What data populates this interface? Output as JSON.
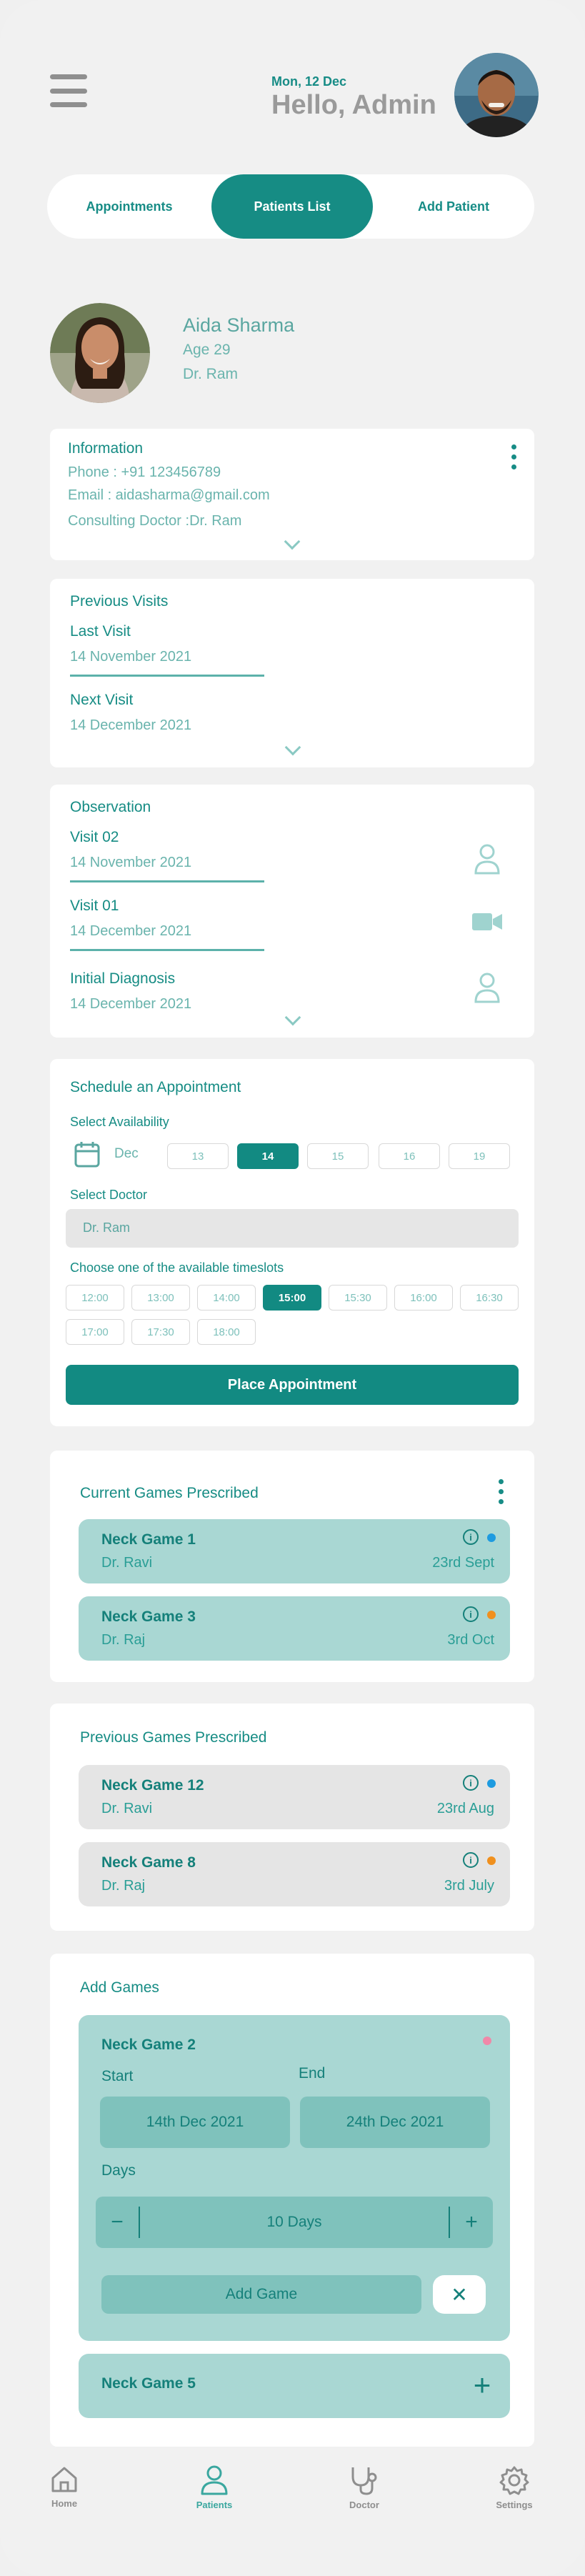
{
  "header": {
    "date": "Mon, 12 Dec",
    "greeting": "Hello, Admin"
  },
  "tabs": [
    {
      "label": "Appointments",
      "active": false
    },
    {
      "label": "Patients List",
      "active": true
    },
    {
      "label": "Add Patient",
      "active": false
    }
  ],
  "patient": {
    "name": "Aida Sharma",
    "age": "Age 29",
    "doctor": "Dr. Ram"
  },
  "information": {
    "title": "Information",
    "phone": "Phone : +91 123456789",
    "email": "Email : aidasharma@gmail.com",
    "consulting": "Consulting Doctor :Dr. Ram"
  },
  "previous_visits": {
    "title": "Previous Visits",
    "last_label": "Last Visit",
    "last_date": "14 November 2021",
    "next_label": "Next Visit",
    "next_date": "14 December 2021"
  },
  "observation": {
    "title": "Observation",
    "items": [
      {
        "label": "Visit 02",
        "date": "14 November 2021",
        "icon": "person-icon"
      },
      {
        "label": "Visit 01",
        "date": "14 December 2021",
        "icon": "video-icon"
      },
      {
        "label": "Initial Diagnosis",
        "date": "14 December 2021",
        "icon": "person-icon"
      }
    ]
  },
  "schedule": {
    "title": "Schedule an Appointment",
    "availability_label": "Select Availability",
    "month": "Dec",
    "days": [
      "13",
      "14",
      "15",
      "16",
      "19"
    ],
    "selected_day": "14",
    "doctor_label": "Select Doctor",
    "doctor_value": "Dr. Ram",
    "timeslot_label": "Choose one of the available timeslots",
    "timeslots": [
      "12:00",
      "13:00",
      "14:00",
      "15:00",
      "15:30",
      "16:00",
      "16:30",
      "17:00",
      "17:30",
      "18:00"
    ],
    "selected_time": "15:00",
    "button": "Place Appointment"
  },
  "current_games": {
    "title": "Current Games Prescribed",
    "items": [
      {
        "name": "Neck Game 1",
        "doctor": "Dr. Ravi",
        "date": "23rd Sept",
        "dot_color": "#1e9be0"
      },
      {
        "name": "Neck Game 3",
        "doctor": "Dr. Raj",
        "date": "3rd Oct",
        "dot_color": "#f0901e"
      }
    ]
  },
  "previous_games": {
    "title": "Previous Games Prescribed",
    "items": [
      {
        "name": "Neck Game 12",
        "doctor": "Dr. Ravi",
        "date": "23rd Aug",
        "dot_color": "#1e9be0"
      },
      {
        "name": "Neck Game 8",
        "doctor": "Dr. Raj",
        "date": "3rd July",
        "dot_color": "#f0901e"
      }
    ]
  },
  "add_games": {
    "title": "Add Games",
    "game_name": "Neck Game 2",
    "start_label": "Start",
    "end_label": "End",
    "start_value": "14th Dec 2021",
    "end_value": "24th Dec 2021",
    "days_label": "Days",
    "days_value": "10 Days",
    "minus": "−",
    "plus": "+",
    "add_button": "Add Game",
    "close": "✕",
    "other_game": "Neck Game 5",
    "other_plus": "+"
  },
  "bottom_nav": [
    {
      "label": "Home",
      "icon": "home-icon",
      "active": false
    },
    {
      "label": "Patients",
      "icon": "person-icon",
      "active": true
    },
    {
      "label": "Doctor",
      "icon": "stethoscope-icon",
      "active": false
    },
    {
      "label": "Settings",
      "icon": "gear-icon",
      "active": false
    }
  ],
  "colors": {
    "primary": "#128a82",
    "accent_light": "#a9d7d3",
    "background": "#f1f1f1"
  }
}
